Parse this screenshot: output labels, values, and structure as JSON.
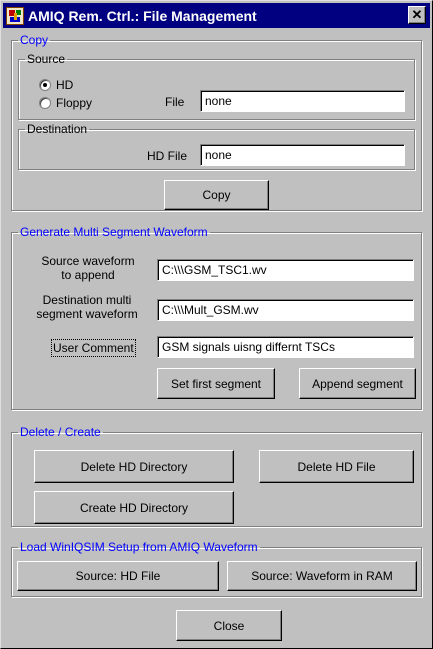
{
  "window": {
    "title": "AMIQ Rem. Ctrl.: File Management",
    "close_glyph": "✕"
  },
  "copy": {
    "group_label": "Copy",
    "source": {
      "group_label": "Source",
      "options": [
        {
          "label": "HD",
          "selected": true
        },
        {
          "label": "Floppy",
          "selected": false
        }
      ],
      "file_label": "File",
      "file_value": "none"
    },
    "destination": {
      "group_label": "Destination",
      "hd_file_label": "HD File",
      "hd_file_value": "none"
    },
    "copy_button": "Copy"
  },
  "multi_segment": {
    "group_label": "Generate Multi Segment Waveform",
    "source_label_1": "Source waveform",
    "source_label_2": "to append",
    "source_value": "C:\\\\\\GSM_TSC1.wv",
    "dest_label_1": "Destination multi",
    "dest_label_2": "segment waveform",
    "dest_value": "C:\\\\\\Mult_GSM.wv",
    "comment_label": "User Comment",
    "comment_value": "GSM signals uisng differnt TSCs",
    "set_first_button": "Set first segment",
    "append_button": "Append segment"
  },
  "delete_create": {
    "group_label": "Delete / Create",
    "delete_dir_button": "Delete HD Directory",
    "delete_file_button": "Delete HD File",
    "create_dir_button": "Create HD Directory"
  },
  "load_setup": {
    "group_label": "Load WinIQSIM Setup from AMIQ Waveform",
    "hd_file_button": "Source: HD File",
    "ram_button": "Source: Waveform in RAM"
  },
  "close_button": "Close",
  "colors": {
    "title_bar": "#000080",
    "group_label_blue": "#0000ff",
    "face": "#c0c0c0"
  }
}
